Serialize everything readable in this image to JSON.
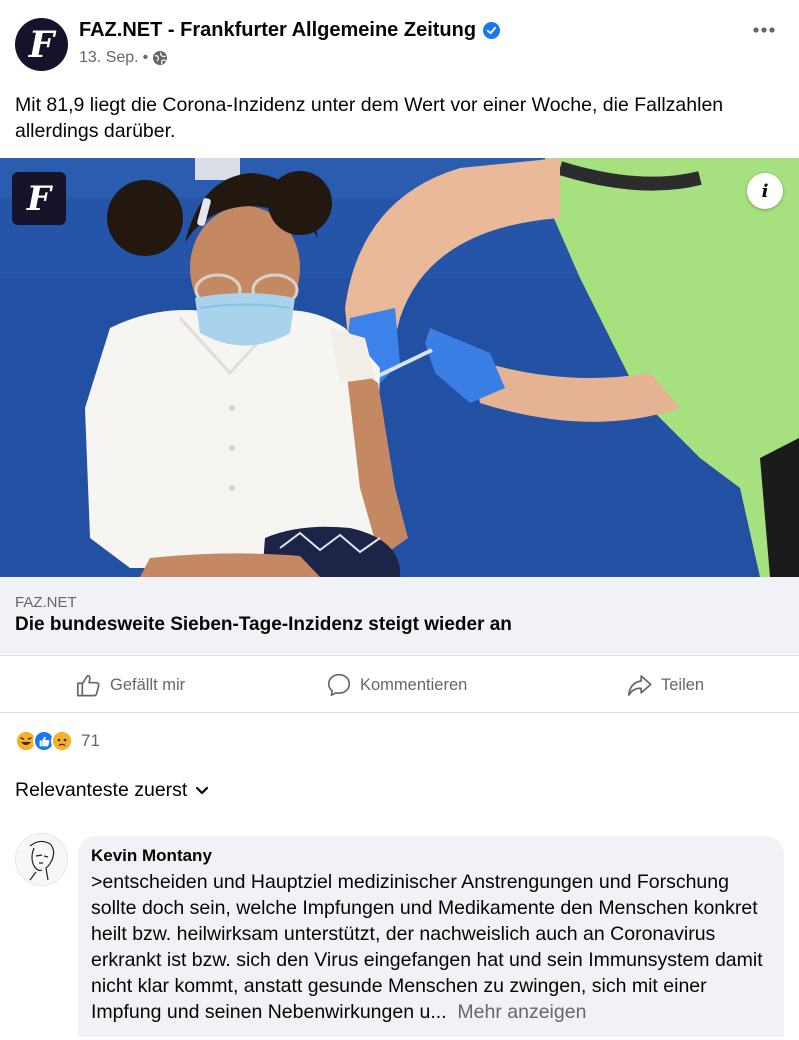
{
  "post": {
    "page_name": "FAZ.NET - Frankfurter Allgemeine Zeitung",
    "date": "13. Sep.",
    "separator": "•",
    "avatar_letter": "F",
    "text": "Mit 81,9 liegt die Corona-Inzidenz unter dem Wert vor einer Woche, die Fallzahlen allerdings darüber."
  },
  "image": {
    "logo_letter": "F",
    "info_label": "i"
  },
  "link": {
    "domain": "FAZ.NET",
    "title": "Die bundesweite Sieben-Tage-Inzidenz steigt wieder an"
  },
  "actions": {
    "like": "Gefällt mir",
    "comment": "Kommentieren",
    "share": "Teilen"
  },
  "reactions": {
    "count": "71",
    "types": [
      "haha-icon",
      "like-icon",
      "sad-icon"
    ]
  },
  "sort": {
    "label": "Relevanteste zuerst"
  },
  "comment": {
    "author": "Kevin Montany",
    "text": ">entscheiden und Hauptziel  medizinischer  Anstrengungen und Forschung sollte doch sein, welche Impfungen und Medikamente den Menschen konkret heilt bzw. heilwirksam  unterstützt, der nachweislich auch an Coronavirus  erkrankt ist bzw. sich den Virus eingefangen hat und sein Immunsystem damit nicht klar kommt, anstatt  gesunde Menschen zu zwingen, sich mit einer Impfung und seinen Nebenwirkungen u...",
    "see_more": "Mehr anzeigen"
  },
  "colors": {
    "brand_blue": "#1877f2",
    "secondary_text": "#65676b",
    "bubble_bg": "#f0f2f5",
    "faz_dark": "#15132a"
  }
}
